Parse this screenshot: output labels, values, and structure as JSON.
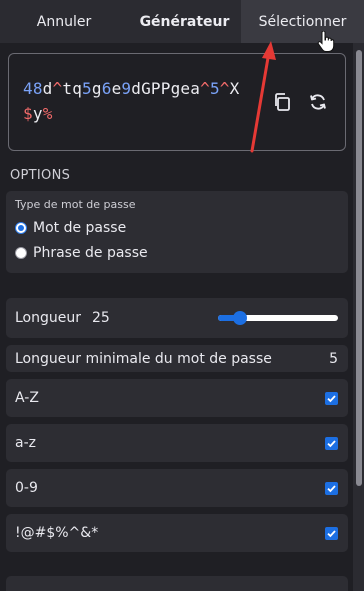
{
  "tabs": {
    "cancel": "Annuler",
    "generator": "Générateur",
    "select": "Sélectionner"
  },
  "password": {
    "segments": [
      {
        "t": "48",
        "k": "digit"
      },
      {
        "t": "d",
        "k": "letter"
      },
      {
        "t": "^",
        "k": "symbol"
      },
      {
        "t": "tq",
        "k": "letter"
      },
      {
        "t": "5",
        "k": "digit"
      },
      {
        "t": "g",
        "k": "letter"
      },
      {
        "t": "6",
        "k": "digit"
      },
      {
        "t": "e",
        "k": "letter"
      },
      {
        "t": "9",
        "k": "digit"
      },
      {
        "t": "dGPPgea",
        "k": "letter"
      },
      {
        "t": "^",
        "k": "symbol"
      },
      {
        "t": "5",
        "k": "digit"
      },
      {
        "t": "^",
        "k": "symbol"
      },
      {
        "t": "X",
        "k": "letter"
      },
      {
        "t": "$",
        "k": "symbol"
      },
      {
        "t": "y",
        "k": "letter"
      },
      {
        "t": "%",
        "k": "symbol"
      }
    ],
    "copy_icon": "copy-icon",
    "refresh_icon": "refresh-icon"
  },
  "options": {
    "title": "OPTIONS",
    "type_legend": "Type de mot de passe",
    "type_options": [
      "Mot de passe",
      "Phrase de passe"
    ],
    "type_selected": 0
  },
  "length": {
    "label": "Longueur",
    "value": "25",
    "slider_fraction": 0.18
  },
  "min_length": {
    "label": "Longueur minimale du mot de passe",
    "value": "5"
  },
  "checks": [
    {
      "label": "A-Z",
      "checked": true
    },
    {
      "label": "a-z",
      "checked": true
    },
    {
      "label": "0-9",
      "checked": true
    },
    {
      "label": "!@#$%^&*",
      "checked": true
    }
  ],
  "colors": {
    "accent": "#1c6fe3",
    "digit": "#7aa2f7",
    "symbol": "#f06a6a",
    "annotation_arrow": "#e53935"
  }
}
